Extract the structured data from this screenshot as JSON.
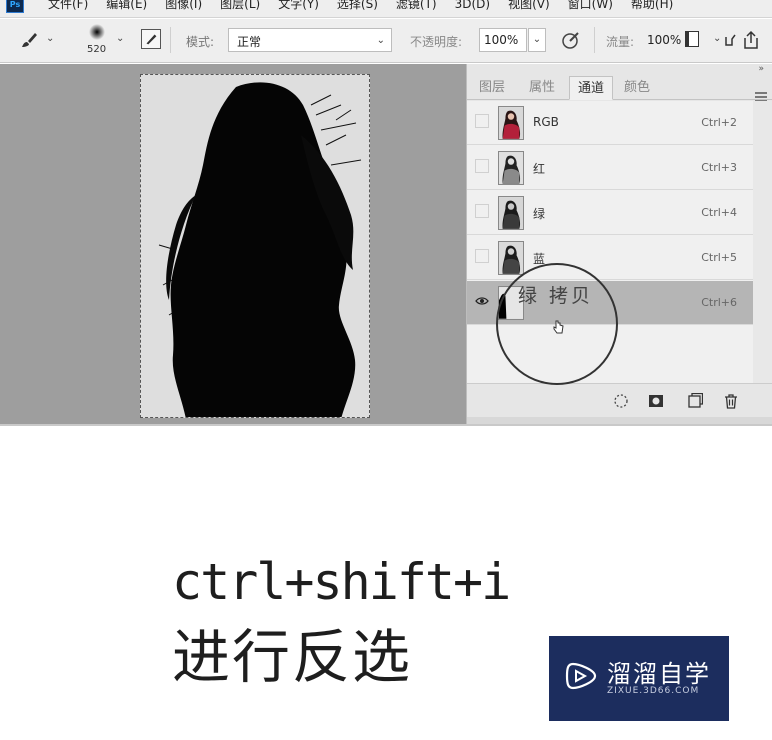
{
  "app": {
    "logo_text": "Ps"
  },
  "menubar": {
    "items": [
      "文件(F)",
      "编辑(E)",
      "图像(I)",
      "图层(L)",
      "文字(Y)",
      "选择(S)",
      "滤镜(T)",
      "3D(D)",
      "视图(V)",
      "窗口(W)",
      "帮助(H)"
    ]
  },
  "options": {
    "brush_size": "520",
    "mode_label": "模式:",
    "mode_value": "正常",
    "opacity_label": "不透明度:",
    "opacity_value": "100%",
    "flow_label": "流量:",
    "flow_value": "100%"
  },
  "panel": {
    "collapse_glyph": "»",
    "tabs": [
      "图层",
      "属性",
      "通道",
      "颜色"
    ],
    "active_tab": "通道",
    "channels": [
      {
        "name": "RGB",
        "shortcut": "Ctrl+2",
        "visible": false,
        "selected": false
      },
      {
        "name": "红",
        "shortcut": "Ctrl+3",
        "visible": false,
        "selected": false
      },
      {
        "name": "绿",
        "shortcut": "Ctrl+4",
        "visible": false,
        "selected": false
      },
      {
        "name": "蓝",
        "shortcut": "Ctrl+5",
        "visible": false,
        "selected": false
      },
      {
        "name": "绿 拷贝",
        "shortcut": "Ctrl+6",
        "visible": true,
        "selected": true
      }
    ],
    "footer_icons": [
      "load-selection-icon",
      "save-selection-icon",
      "new-channel-icon",
      "trash-icon"
    ]
  },
  "magnifier": {
    "text": "绿 拷贝"
  },
  "caption": {
    "shortcut": "ctrl+shift+i",
    "action": "进行反选"
  },
  "watermark": {
    "title": "溜溜自学",
    "url": "ZIXUE.3D66.COM"
  },
  "colors": {
    "workspace": "#9e9e9e",
    "selected_row": "#b5b5b5",
    "watermark_bg": "#1c2d5e"
  }
}
